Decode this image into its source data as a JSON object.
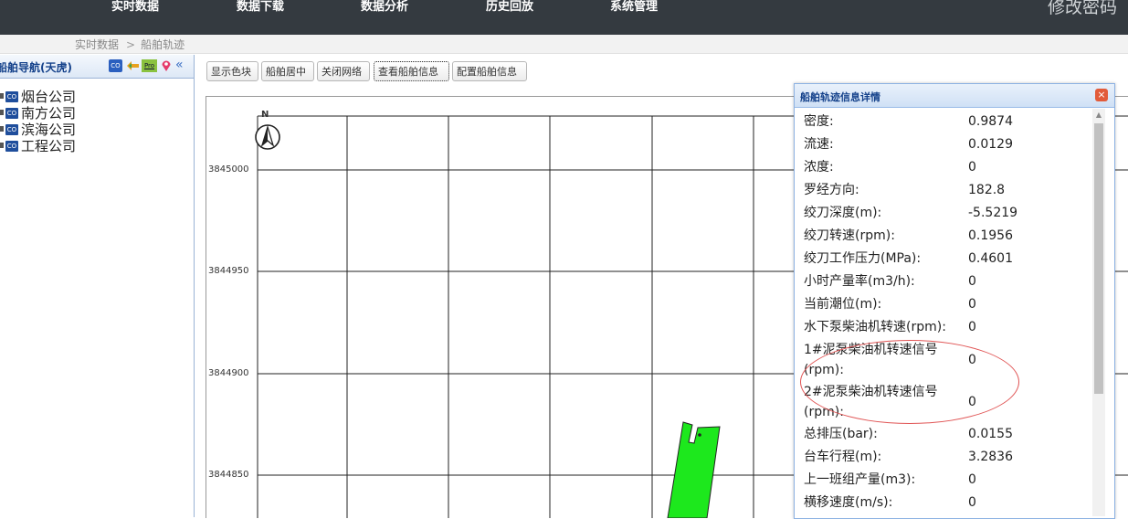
{
  "nav": {
    "items": [
      "实时数据",
      "数据下载",
      "数据分析",
      "历史回放",
      "系统管理"
    ],
    "change_password": "修改密码"
  },
  "breadcrumb": {
    "root": "实时数据",
    "separator": ">",
    "current": "船舶轨迹"
  },
  "left_panel": {
    "title": "船舶导航(天虎)",
    "tree": [
      "烟台公司",
      "南方公司",
      "滨海公司",
      "工程公司"
    ],
    "icon_labels": {
      "co": "CO",
      "pro": "Pro"
    }
  },
  "toolbar": {
    "show_color_block": "显示色块",
    "center_ship": "船舶居中",
    "close_grid": "关闭网络",
    "view_ship_info": "查看船舶信息",
    "config_ship_info": "配置船舶信息"
  },
  "map": {
    "north_label": "N",
    "y_labels": [
      "3845000",
      "3844950",
      "3844900",
      "3844850"
    ]
  },
  "info_window": {
    "title": "船舶轨迹信息详情",
    "close_symbol": "×",
    "rows": [
      {
        "k": "密度:",
        "v": "0.9874"
      },
      {
        "k": "流速:",
        "v": "0.0129"
      },
      {
        "k": "浓度:",
        "v": "0"
      },
      {
        "k": "罗经方向:",
        "v": "182.8"
      },
      {
        "k": "绞刀深度(m):",
        "v": "-5.5219"
      },
      {
        "k": "绞刀转速(rpm):",
        "v": "0.1956"
      },
      {
        "k": "绞刀工作压力(MPa):",
        "v": "0.4601"
      },
      {
        "k": "小时产量率(m3/h):",
        "v": "0"
      },
      {
        "k": "当前潮位(m):",
        "v": "0"
      },
      {
        "k": "水下泵柴油机转速(rpm):",
        "v": "0"
      },
      {
        "k": "1#泥泵柴油机转速信号(rpm):",
        "v": "0"
      },
      {
        "k": "2#泥泵柴油机转速信号(rpm):",
        "v": "0"
      },
      {
        "k": "总排压(bar):",
        "v": "0.0155"
      },
      {
        "k": "台车行程(m):",
        "v": "3.2836"
      },
      {
        "k": "上一班组产量(m3):",
        "v": "0"
      },
      {
        "k": "横移速度(m/s):",
        "v": "0"
      }
    ]
  },
  "colors": {
    "topbar": "#343a40",
    "ship": "#1de81d",
    "highlight_ellipse": "#e05454"
  }
}
